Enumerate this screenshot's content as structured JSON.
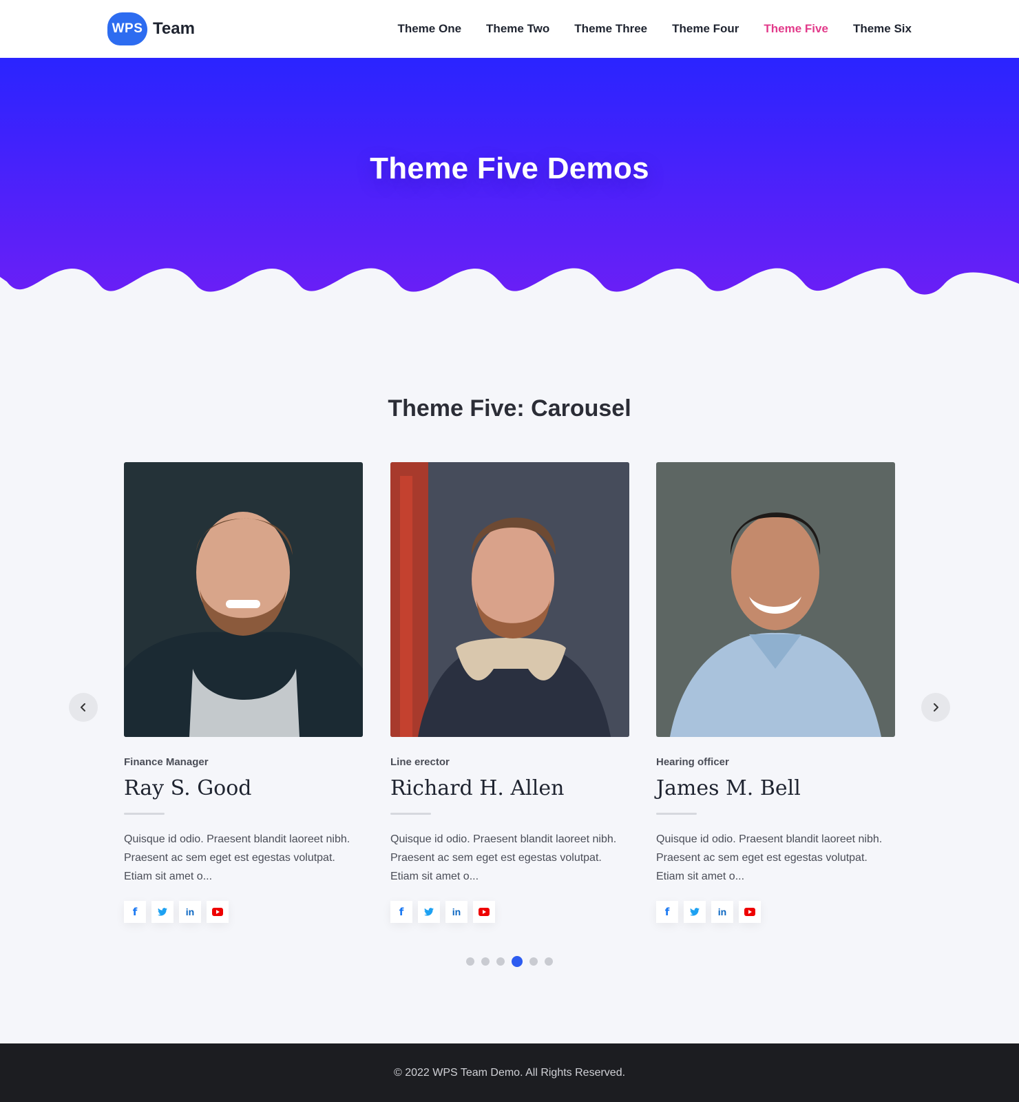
{
  "header": {
    "logo_badge": "WPS",
    "logo_text": "Team",
    "nav": [
      "Theme One",
      "Theme Two",
      "Theme Three",
      "Theme Four",
      "Theme Five",
      "Theme Six"
    ],
    "active_nav": "Theme Five"
  },
  "hero": {
    "title": "Theme Five Demos",
    "gradient_top": "#2a24ff",
    "gradient_bottom": "#6a1ff6"
  },
  "section": {
    "title": "Theme Five: Carousel"
  },
  "members": [
    {
      "role": "Finance Manager",
      "name": "Ray S. Good",
      "description": "Quisque id odio. Praesent blandit laoreet nibh. Praesent ac sem eget est egestas volutpat. Etiam sit amet o..."
    },
    {
      "role": "Line erector",
      "name": "Richard H. Allen",
      "description": "Quisque id odio. Praesent blandit laoreet nibh. Praesent ac sem eget est egestas volutpat. Etiam sit amet o..."
    },
    {
      "role": "Hearing officer",
      "name": "James M. Bell",
      "description": "Quisque id odio. Praesent blandit laoreet nibh. Praesent ac sem eget est egestas volutpat. Etiam sit amet o..."
    }
  ],
  "social_icons": [
    "facebook-icon",
    "twitter-icon",
    "linkedin-icon",
    "youtube-icon"
  ],
  "carousel": {
    "dot_count": 6,
    "active_dot": 4
  },
  "footer": {
    "text": "© 2022 WPS Team Demo. All Rights Reserved."
  },
  "colors": {
    "accent": "#2d5cf0",
    "nav_active": "#e23a8a",
    "footer_bg": "#1c1d21"
  }
}
